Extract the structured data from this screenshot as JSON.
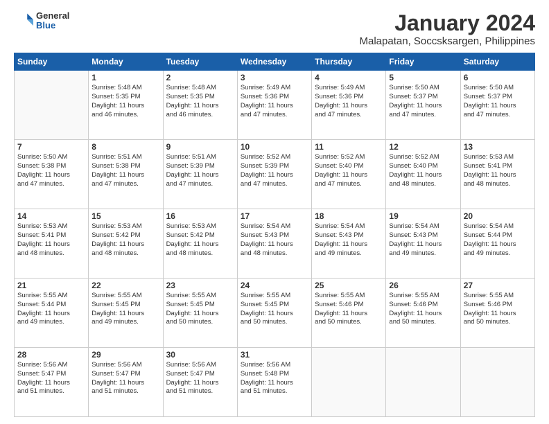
{
  "header": {
    "logo_general": "General",
    "logo_blue": "Blue",
    "main_title": "January 2024",
    "subtitle": "Malapatan, Soccsksargen, Philippines"
  },
  "days_of_week": [
    "Sunday",
    "Monday",
    "Tuesday",
    "Wednesday",
    "Thursday",
    "Friday",
    "Saturday"
  ],
  "weeks": [
    [
      {
        "day": "",
        "content": ""
      },
      {
        "day": "1",
        "content": "Sunrise: 5:48 AM\nSunset: 5:35 PM\nDaylight: 11 hours\nand 46 minutes."
      },
      {
        "day": "2",
        "content": "Sunrise: 5:48 AM\nSunset: 5:35 PM\nDaylight: 11 hours\nand 46 minutes."
      },
      {
        "day": "3",
        "content": "Sunrise: 5:49 AM\nSunset: 5:36 PM\nDaylight: 11 hours\nand 47 minutes."
      },
      {
        "day": "4",
        "content": "Sunrise: 5:49 AM\nSunset: 5:36 PM\nDaylight: 11 hours\nand 47 minutes."
      },
      {
        "day": "5",
        "content": "Sunrise: 5:50 AM\nSunset: 5:37 PM\nDaylight: 11 hours\nand 47 minutes."
      },
      {
        "day": "6",
        "content": "Sunrise: 5:50 AM\nSunset: 5:37 PM\nDaylight: 11 hours\nand 47 minutes."
      }
    ],
    [
      {
        "day": "7",
        "content": "Sunrise: 5:50 AM\nSunset: 5:38 PM\nDaylight: 11 hours\nand 47 minutes."
      },
      {
        "day": "8",
        "content": "Sunrise: 5:51 AM\nSunset: 5:38 PM\nDaylight: 11 hours\nand 47 minutes."
      },
      {
        "day": "9",
        "content": "Sunrise: 5:51 AM\nSunset: 5:39 PM\nDaylight: 11 hours\nand 47 minutes."
      },
      {
        "day": "10",
        "content": "Sunrise: 5:52 AM\nSunset: 5:39 PM\nDaylight: 11 hours\nand 47 minutes."
      },
      {
        "day": "11",
        "content": "Sunrise: 5:52 AM\nSunset: 5:40 PM\nDaylight: 11 hours\nand 47 minutes."
      },
      {
        "day": "12",
        "content": "Sunrise: 5:52 AM\nSunset: 5:40 PM\nDaylight: 11 hours\nand 48 minutes."
      },
      {
        "day": "13",
        "content": "Sunrise: 5:53 AM\nSunset: 5:41 PM\nDaylight: 11 hours\nand 48 minutes."
      }
    ],
    [
      {
        "day": "14",
        "content": "Sunrise: 5:53 AM\nSunset: 5:41 PM\nDaylight: 11 hours\nand 48 minutes."
      },
      {
        "day": "15",
        "content": "Sunrise: 5:53 AM\nSunset: 5:42 PM\nDaylight: 11 hours\nand 48 minutes."
      },
      {
        "day": "16",
        "content": "Sunrise: 5:53 AM\nSunset: 5:42 PM\nDaylight: 11 hours\nand 48 minutes."
      },
      {
        "day": "17",
        "content": "Sunrise: 5:54 AM\nSunset: 5:43 PM\nDaylight: 11 hours\nand 48 minutes."
      },
      {
        "day": "18",
        "content": "Sunrise: 5:54 AM\nSunset: 5:43 PM\nDaylight: 11 hours\nand 49 minutes."
      },
      {
        "day": "19",
        "content": "Sunrise: 5:54 AM\nSunset: 5:43 PM\nDaylight: 11 hours\nand 49 minutes."
      },
      {
        "day": "20",
        "content": "Sunrise: 5:54 AM\nSunset: 5:44 PM\nDaylight: 11 hours\nand 49 minutes."
      }
    ],
    [
      {
        "day": "21",
        "content": "Sunrise: 5:55 AM\nSunset: 5:44 PM\nDaylight: 11 hours\nand 49 minutes."
      },
      {
        "day": "22",
        "content": "Sunrise: 5:55 AM\nSunset: 5:45 PM\nDaylight: 11 hours\nand 49 minutes."
      },
      {
        "day": "23",
        "content": "Sunrise: 5:55 AM\nSunset: 5:45 PM\nDaylight: 11 hours\nand 50 minutes."
      },
      {
        "day": "24",
        "content": "Sunrise: 5:55 AM\nSunset: 5:45 PM\nDaylight: 11 hours\nand 50 minutes."
      },
      {
        "day": "25",
        "content": "Sunrise: 5:55 AM\nSunset: 5:46 PM\nDaylight: 11 hours\nand 50 minutes."
      },
      {
        "day": "26",
        "content": "Sunrise: 5:55 AM\nSunset: 5:46 PM\nDaylight: 11 hours\nand 50 minutes."
      },
      {
        "day": "27",
        "content": "Sunrise: 5:55 AM\nSunset: 5:46 PM\nDaylight: 11 hours\nand 50 minutes."
      }
    ],
    [
      {
        "day": "28",
        "content": "Sunrise: 5:56 AM\nSunset: 5:47 PM\nDaylight: 11 hours\nand 51 minutes."
      },
      {
        "day": "29",
        "content": "Sunrise: 5:56 AM\nSunset: 5:47 PM\nDaylight: 11 hours\nand 51 minutes."
      },
      {
        "day": "30",
        "content": "Sunrise: 5:56 AM\nSunset: 5:47 PM\nDaylight: 11 hours\nand 51 minutes."
      },
      {
        "day": "31",
        "content": "Sunrise: 5:56 AM\nSunset: 5:48 PM\nDaylight: 11 hours\nand 51 minutes."
      },
      {
        "day": "",
        "content": ""
      },
      {
        "day": "",
        "content": ""
      },
      {
        "day": "",
        "content": ""
      }
    ]
  ]
}
